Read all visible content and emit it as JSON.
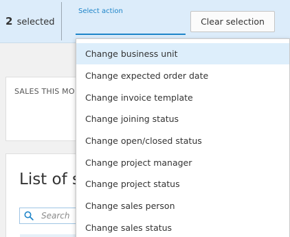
{
  "selection_bar": {
    "count": "2",
    "count_suffix": "selected",
    "action_label": "Select action",
    "clear_button": "Clear selection"
  },
  "sales_card": {
    "title": "SALES THIS MO"
  },
  "list_card": {
    "title": "List of s",
    "search_placeholder": "Search"
  },
  "action_options": [
    "Change business unit",
    "Change expected order date",
    "Change invoice template",
    "Change joining status",
    "Change open/closed status",
    "Change project manager",
    "Change project status",
    "Change sales person",
    "Change sales status"
  ],
  "highlighted_option": "Change business unit",
  "colors": {
    "accent": "#1d84c8",
    "bar_bg": "#dcecfa",
    "highlight": "#ddeefb"
  }
}
